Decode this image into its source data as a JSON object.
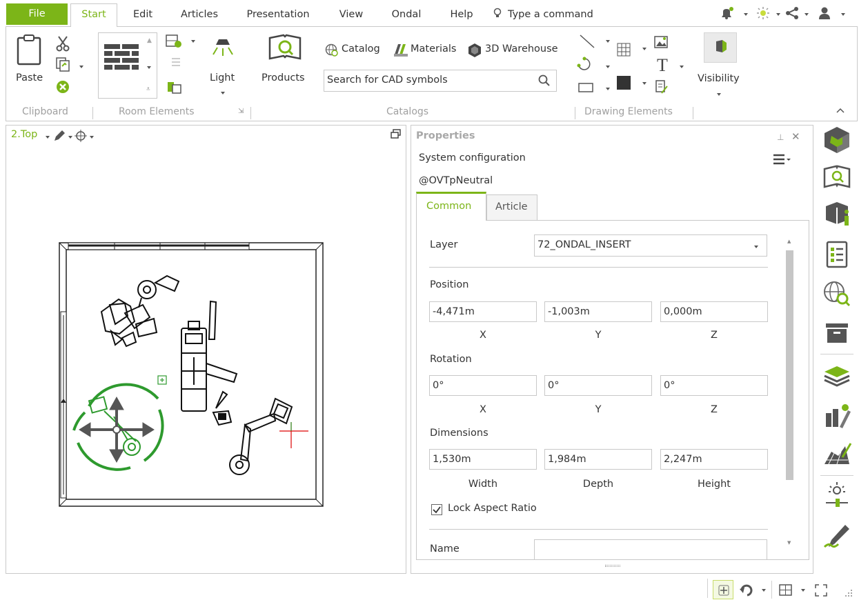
{
  "menu": {
    "file": "File",
    "start": "Start",
    "edit": "Edit",
    "articles": "Articles",
    "presentation": "Presentation",
    "view": "View",
    "ondal": "Ondal",
    "help": "Help",
    "command_placeholder": "Type a command"
  },
  "ribbon": {
    "paste": "Paste",
    "light": "Light",
    "products": "Products",
    "catalog": "Catalog",
    "materials": "Materials",
    "warehouse": "3D Warehouse",
    "search_placeholder": "Search for CAD symbols",
    "visibility": "Visibility",
    "groups": {
      "clipboard": "Clipboard",
      "room_elements": "Room Elements",
      "catalogs": "Catalogs",
      "drawing_elements": "Drawing Elements"
    }
  },
  "viewport": {
    "view_name": "2.Top"
  },
  "properties": {
    "title": "Properties",
    "config": "System configuration",
    "neutral": "@OVTpNeutral",
    "tabs": [
      "Common",
      "Article"
    ],
    "layer_label": "Layer",
    "layer_value": "72_ONDAL_INSERT",
    "position_label": "Position",
    "position": {
      "x": "-4,471m",
      "y": "-1,003m",
      "z": "0,000m"
    },
    "rotation_label": "Rotation",
    "rotation": {
      "x": "0°",
      "y": "0°",
      "z": "0°"
    },
    "dimensions_label": "Dimensions",
    "dimensions": {
      "width": "1,530m",
      "depth": "1,984m",
      "height": "2,247m"
    },
    "axis": {
      "x": "X",
      "y": "Y",
      "z": "Z"
    },
    "dim_labels": {
      "width": "Width",
      "depth": "Depth",
      "height": "Height"
    },
    "lock_aspect": "Lock Aspect Ratio",
    "lock_aspect_checked": true,
    "name_label": "Name",
    "name_value": ""
  },
  "colors": {
    "accent": "#7cb518",
    "selection": "#2e9a2e"
  }
}
